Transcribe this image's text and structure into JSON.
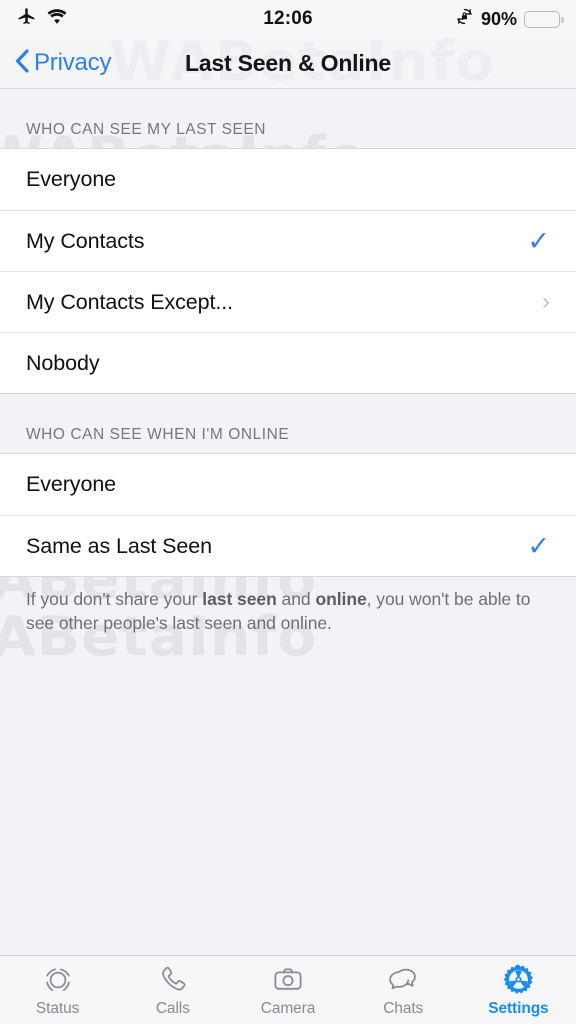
{
  "statusbar": {
    "time": "12:06",
    "battery_percent": "90%",
    "battery_level": 90,
    "icons": [
      "airplane-mode-icon",
      "wifi-icon",
      "rotation-lock-icon",
      "battery-icon"
    ],
    "battery_color": "#FDCE0B"
  },
  "navbar": {
    "back_label": "Privacy",
    "title": "Last Seen & Online",
    "accent_color": "#2D7FF0"
  },
  "watermark": {
    "text": "WABetaInfo"
  },
  "sections": [
    {
      "header": "WHO CAN SEE MY LAST SEEN",
      "rows": [
        {
          "label": "Everyone",
          "accessory": "none"
        },
        {
          "label": "My Contacts",
          "accessory": "check"
        },
        {
          "label": "My Contacts Except...",
          "accessory": "chevron"
        },
        {
          "label": "Nobody",
          "accessory": "none"
        }
      ]
    },
    {
      "header": "WHO CAN SEE WHEN I'M ONLINE",
      "rows": [
        {
          "label": "Everyone",
          "accessory": "none"
        },
        {
          "label": "Same as Last Seen",
          "accessory": "check"
        }
      ],
      "footnote": {
        "part1": "If you don't share your ",
        "bold1": "last seen",
        "part2": " and ",
        "bold2": "online",
        "part3": ", you won't be able to see other people's last seen and online."
      }
    }
  ],
  "tabbar": {
    "accent_color": "#1C8CEB",
    "inactive_color": "#8A8A8F",
    "tabs": [
      {
        "label": "Status",
        "icon": "status-ring-icon",
        "active": false
      },
      {
        "label": "Calls",
        "icon": "phone-icon",
        "active": false
      },
      {
        "label": "Camera",
        "icon": "camera-icon",
        "active": false
      },
      {
        "label": "Chats",
        "icon": "chat-bubbles-icon",
        "active": false
      },
      {
        "label": "Settings",
        "icon": "gear-icon",
        "active": true
      }
    ]
  },
  "symbols": {
    "check": "✓",
    "chevron": "›"
  }
}
